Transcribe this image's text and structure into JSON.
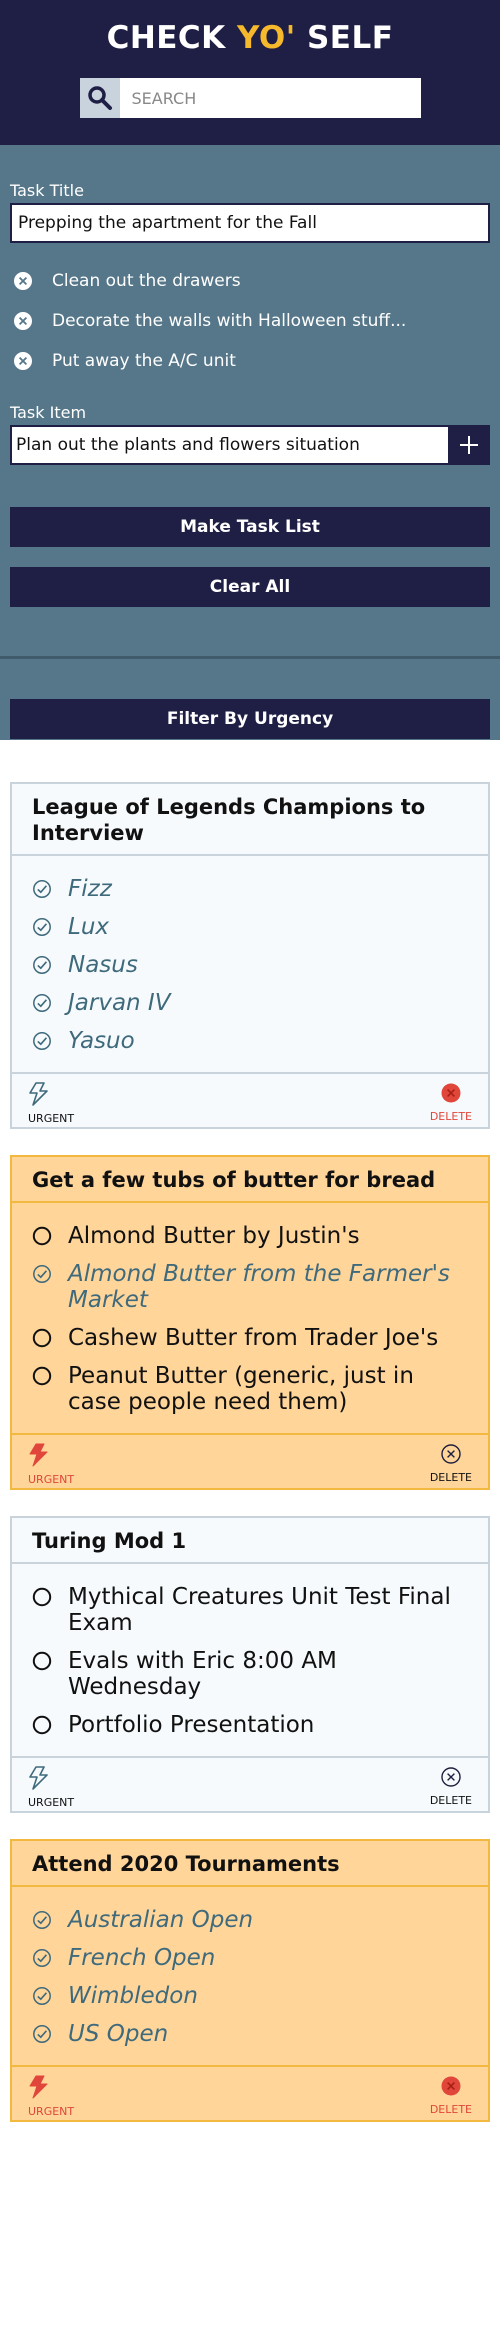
{
  "app": {
    "title_pre": "CHECK ",
    "title_accent": "YO'",
    "title_post": " SELF"
  },
  "search": {
    "placeholder": "SEARCH"
  },
  "sidebar": {
    "task_title_label": "Task Title",
    "task_title_value": "Prepping the apartment for the Fall",
    "draft_items": [
      {
        "text": "Clean out the drawers"
      },
      {
        "text": "Decorate the walls with Halloween stuff..."
      },
      {
        "text": "Put away the A/C unit"
      }
    ],
    "task_item_label": "Task Item",
    "task_item_value": "Plan out the plants and flowers situation",
    "make_label": "Make Task List",
    "clear_label": "Clear All",
    "filter_label": "Filter By Urgency"
  },
  "cards": [
    {
      "title": "League of Legends Champions to Interview",
      "urgent": false,
      "urgent_label": "URGENT",
      "delete_label": "DELETE",
      "delete_active": true,
      "items": [
        {
          "text": "Fizz",
          "checked": true
        },
        {
          "text": "Lux",
          "checked": true
        },
        {
          "text": "Nasus",
          "checked": true
        },
        {
          "text": "Jarvan IV",
          "checked": true
        },
        {
          "text": "Yasuo",
          "checked": true
        }
      ]
    },
    {
      "title": "Get a few tubs of butter for bread",
      "urgent": true,
      "urgent_label": "URGENT",
      "delete_label": "DELETE",
      "delete_active": false,
      "items": [
        {
          "text": "Almond Butter by Justin's",
          "checked": false
        },
        {
          "text": "Almond Butter from the Farmer's Market",
          "checked": true
        },
        {
          "text": "Cashew Butter from Trader Joe's",
          "checked": false
        },
        {
          "text": "Peanut Butter (generic, just in case people need them)",
          "checked": false
        }
      ]
    },
    {
      "title": "Turing Mod 1",
      "urgent": false,
      "urgent_label": "URGENT",
      "delete_label": "DELETE",
      "delete_active": false,
      "items": [
        {
          "text": "Mythical Creatures Unit Test Final Exam",
          "checked": false
        },
        {
          "text": "Evals with Eric 8:00 AM Wednesday",
          "checked": false
        },
        {
          "text": "Portfolio Presentation",
          "checked": false
        }
      ]
    },
    {
      "title": "Attend 2020 Tournaments",
      "urgent": true,
      "urgent_label": "URGENT",
      "delete_label": "DELETE",
      "delete_active": true,
      "items": [
        {
          "text": "Australian Open",
          "checked": true
        },
        {
          "text": "French Open",
          "checked": true
        },
        {
          "text": "Wimbledon",
          "checked": true
        },
        {
          "text": "US Open",
          "checked": true
        }
      ]
    }
  ],
  "colors": {
    "navy": "#1f1f45",
    "slate": "#56778a",
    "accent": "#f5b92b",
    "urgent_card": "#ffd59a",
    "urgent_red": "#e0463a",
    "done_text": "#3f6a7c"
  },
  "icons": {
    "search": "magnifier-icon",
    "draft_remove": "circle-x-icon",
    "add": "plus-icon",
    "check_done": "circle-check-icon",
    "check_todo": "empty-circle-icon",
    "urgent": "lightning-icon",
    "delete_active": "red-circle-x-icon",
    "delete": "circle-x-icon"
  }
}
